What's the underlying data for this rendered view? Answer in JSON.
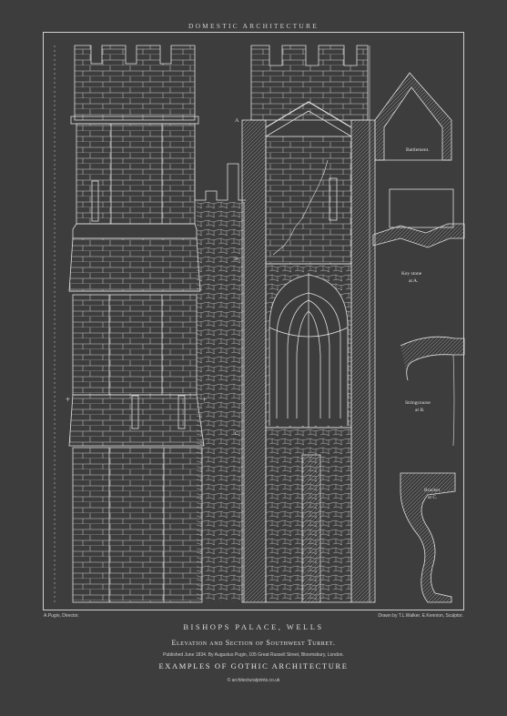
{
  "header": {
    "title": "DOMESTIC ARCHITECTURE"
  },
  "details": {
    "battlement": "Battlement.",
    "keystone_line1": "Key stone",
    "keystone_line2": "at A.",
    "stringcourse_line1": "Stringcourse",
    "stringcourse_line2": "at B.",
    "bracket_line1": "Bracket",
    "bracket_line2": "at C."
  },
  "marks": {
    "a": "A",
    "b": "B",
    "c": "C"
  },
  "credits": {
    "left": "A.Pugin, Director.",
    "right": "Drawn by T.L.Walker. E.Kennion, Sculptor."
  },
  "plate": {
    "title": "BISHOPS PALACE, WELLS",
    "subtitle": "Elevation and Section of Southwest Turret.",
    "publication": "Published June 1834. By Augustus Pugin, 105 Great Russell Street, Bloomsbury, London.",
    "series": "EXAMPLES OF GOTHIC ARCHITECTURE",
    "copyright": "© architecturalprints.co.uk"
  },
  "colors": {
    "background": "#3d3d3d",
    "lines": "#e0e0e0"
  }
}
